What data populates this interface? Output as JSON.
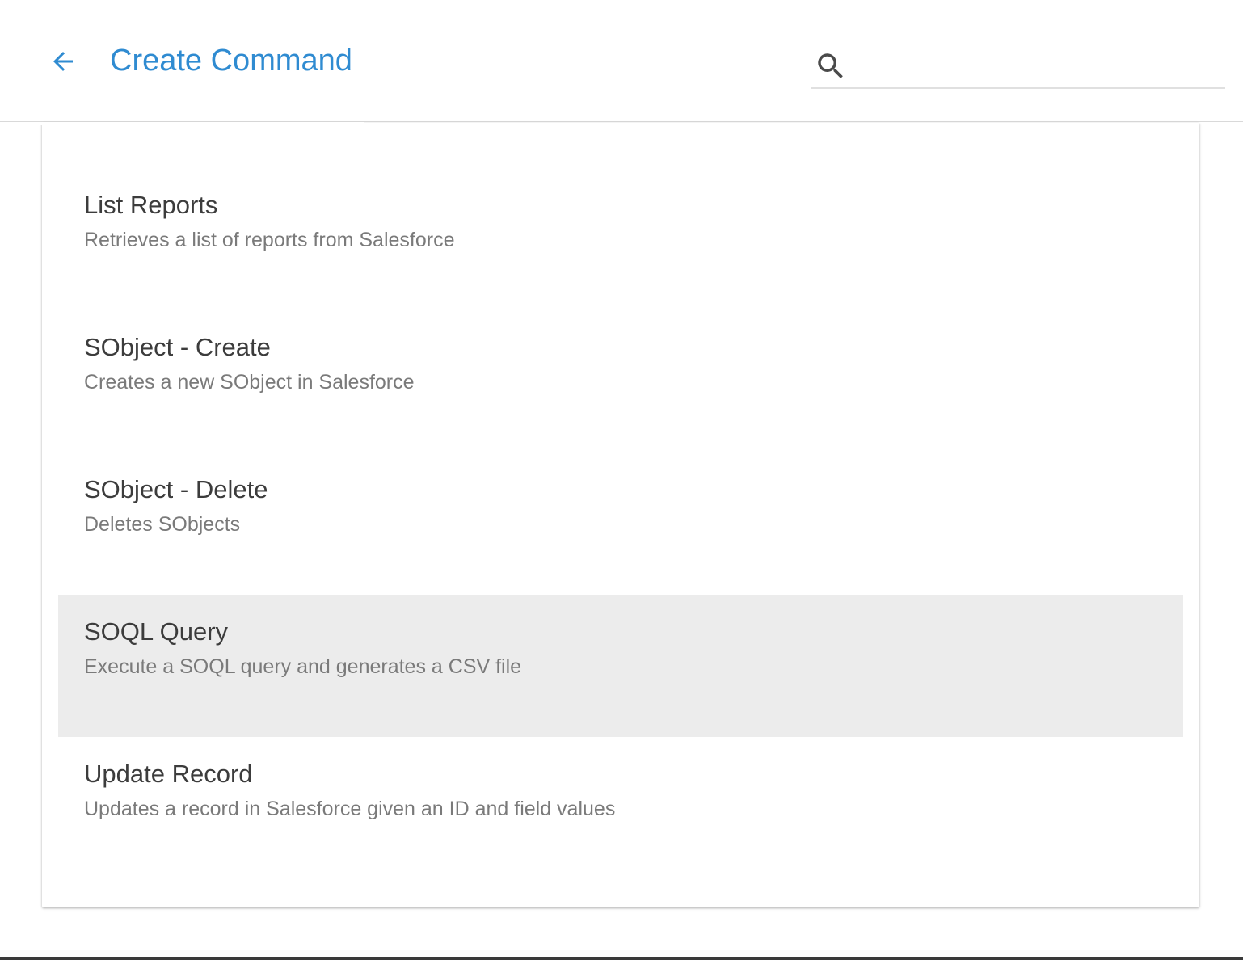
{
  "header": {
    "title": "Create Command",
    "back_icon": "arrow-left-icon",
    "search_icon": "search-icon",
    "search_value": "",
    "search_placeholder": ""
  },
  "colors": {
    "accent": "#2f8bd1",
    "selected_row": "#ececec",
    "name_text": "#3c3c3c",
    "description_text": "#7a7a7a"
  },
  "commands": [
    {
      "name": "List Reports",
      "description": "Retrieves a list of reports from Salesforce",
      "selected": false
    },
    {
      "name": "SObject - Create",
      "description": "Creates a new SObject in Salesforce",
      "selected": false
    },
    {
      "name": "SObject - Delete",
      "description": "Deletes SObjects",
      "selected": false
    },
    {
      "name": "SOQL Query",
      "description": "Execute a SOQL query and generates a CSV file",
      "selected": true
    },
    {
      "name": "Update Record",
      "description": "Updates a record in Salesforce given an ID and field values",
      "selected": false
    }
  ]
}
